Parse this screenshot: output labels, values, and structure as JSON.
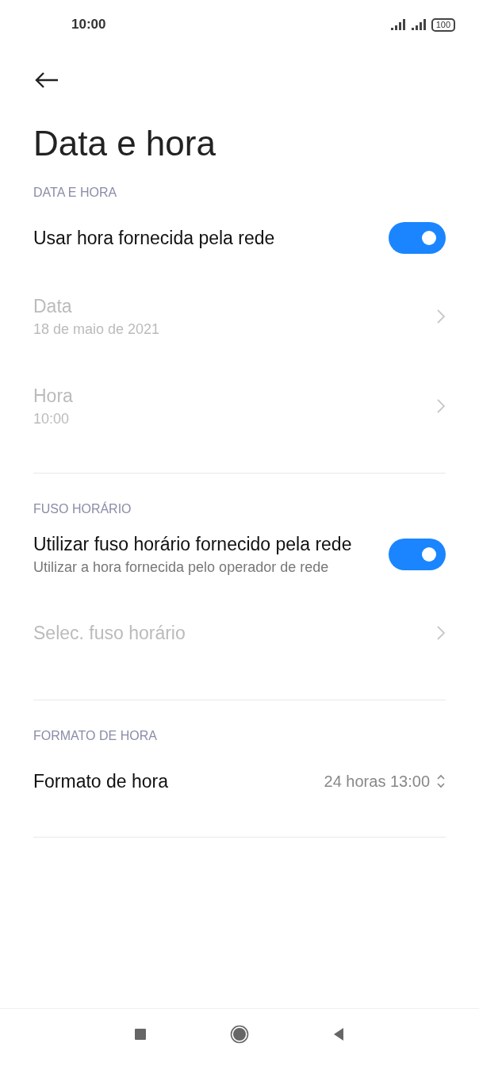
{
  "status_bar": {
    "time": "10:00",
    "battery": "100"
  },
  "title": "Data e hora",
  "sections": [
    {
      "header": "DATA E HORA",
      "items": [
        {
          "kind": "toggle",
          "title": "Usar hora fornecida pela rede",
          "on": true,
          "disabled": false
        },
        {
          "kind": "link",
          "title": "Data",
          "subtitle": "18 de maio de 2021",
          "disabled": true
        },
        {
          "kind": "link",
          "title": "Hora",
          "subtitle": "10:00",
          "disabled": true
        }
      ]
    },
    {
      "header": "FUSO HORÁRIO",
      "items": [
        {
          "kind": "toggle",
          "title": "Utilizar fuso horário fornecido pela rede",
          "subtitle": "Utilizar a hora fornecida pelo operador de rede",
          "on": true,
          "disabled": false
        },
        {
          "kind": "link",
          "title": "Selec. fuso horário",
          "disabled": true
        }
      ]
    },
    {
      "header": "FORMATO DE HORA",
      "items": [
        {
          "kind": "select",
          "title": "Formato de hora",
          "value": "24 horas 13:00",
          "disabled": false
        }
      ]
    }
  ]
}
